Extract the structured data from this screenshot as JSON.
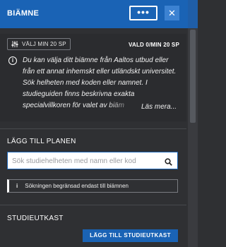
{
  "header": {
    "title": "BIÄMNE",
    "more_label": "•••",
    "close_label": "✕"
  },
  "info": {
    "filter_label": "VÄLJ MIN 20 SP",
    "vald_label": "VALD 0/MIN 20 SP",
    "info_mark": "i",
    "text": "Du kan välja ditt biämne från Aaltos utbud eller från ett annat inhemskt eller utländskt universitet.  Sök helheten med koden eller namnet. I studieguiden finns beskrivna exakta specialvillkoren för valet av biäm",
    "read_more": "Läs mera..."
  },
  "add_to_plan": {
    "title": "LÄGG TILL PLANEN",
    "search_placeholder": "Sök studiehelheten med namn eller kod",
    "search_value": "",
    "notice_mark": "i",
    "notice": "Sökningen begränsad endast till biämnen"
  },
  "draft": {
    "title": "STUDIEUTKAST",
    "add_button": "LÄGG TILL STUDIEUTKAST"
  },
  "icons": {
    "filter": "filter-sliders-icon",
    "info": "info-icon",
    "search": "search-icon",
    "close": "close-icon",
    "more": "more-dots-icon"
  },
  "colors": {
    "accent": "#1a63b5",
    "panel_bg": "#2f3033",
    "info_bg": "#2b2c2f"
  }
}
